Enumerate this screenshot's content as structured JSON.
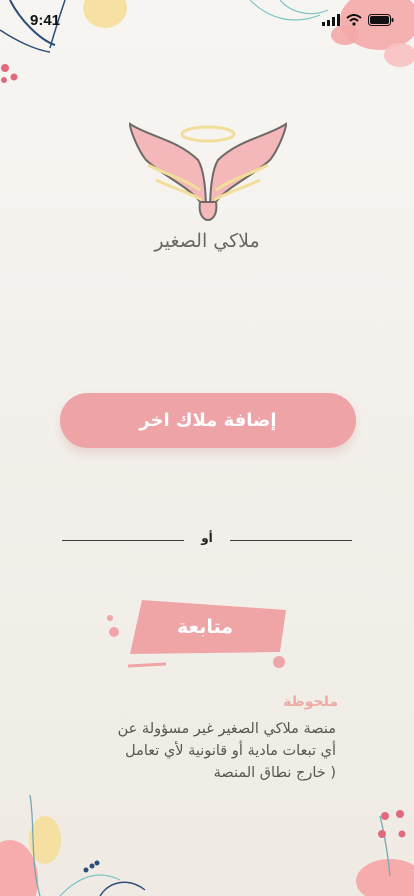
{
  "status_bar": {
    "time": "9:41"
  },
  "logo": {
    "text": "ملاكي الصغير"
  },
  "actions": {
    "add_button": "إضافة ملاك اخر",
    "or": "أو",
    "follow": "متابعة"
  },
  "note": {
    "title": "ملحوظة",
    "lines": [
      "منصة ملاكي الصغير غير مسؤولة عن",
      "أي تبعات مادية أو قانونية لأي تعامل",
      "( خارج نطاق المنصة"
    ]
  },
  "colors": {
    "accent": "#eea4a6",
    "note_title": "#eeaaa5",
    "background": "#f4f1ed"
  }
}
